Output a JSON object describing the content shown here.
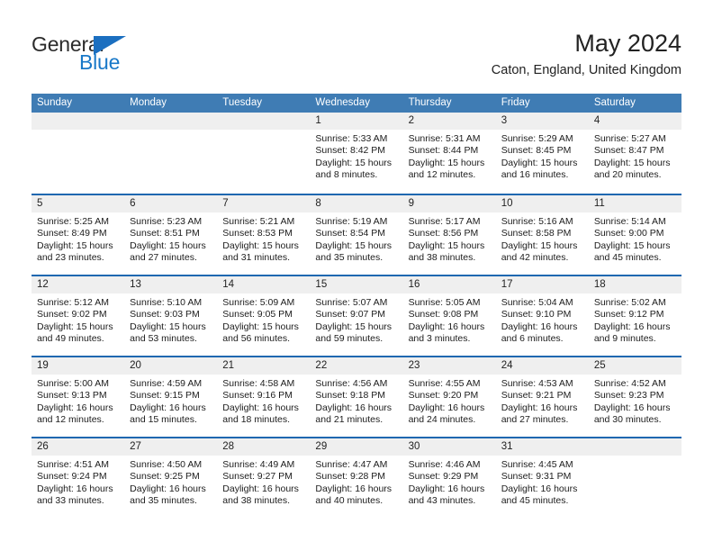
{
  "brand": {
    "name_part1": "General",
    "name_part2": "Blue",
    "logo_icon": "triangle-flag-icon",
    "accent_color": "#1878c8"
  },
  "header": {
    "title": "May 2024",
    "subtitle": "Caton, England, United Kingdom"
  },
  "colors": {
    "weekday_header_bg": "#3f7cb4",
    "week_divider": "#1f68b0",
    "daynum_band_bg": "#efefef",
    "text": "#1c1c1c"
  },
  "weekdays": [
    "Sunday",
    "Monday",
    "Tuesday",
    "Wednesday",
    "Thursday",
    "Friday",
    "Saturday"
  ],
  "weeks": [
    [
      {
        "day": "",
        "empty": true
      },
      {
        "day": "",
        "empty": true
      },
      {
        "day": "",
        "empty": true
      },
      {
        "day": "1",
        "sunrise": "Sunrise: 5:33 AM",
        "sunset": "Sunset: 8:42 PM",
        "daylight_l1": "Daylight: 15 hours",
        "daylight_l2": "and 8 minutes."
      },
      {
        "day": "2",
        "sunrise": "Sunrise: 5:31 AM",
        "sunset": "Sunset: 8:44 PM",
        "daylight_l1": "Daylight: 15 hours",
        "daylight_l2": "and 12 minutes."
      },
      {
        "day": "3",
        "sunrise": "Sunrise: 5:29 AM",
        "sunset": "Sunset: 8:45 PM",
        "daylight_l1": "Daylight: 15 hours",
        "daylight_l2": "and 16 minutes."
      },
      {
        "day": "4",
        "sunrise": "Sunrise: 5:27 AM",
        "sunset": "Sunset: 8:47 PM",
        "daylight_l1": "Daylight: 15 hours",
        "daylight_l2": "and 20 minutes."
      }
    ],
    [
      {
        "day": "5",
        "sunrise": "Sunrise: 5:25 AM",
        "sunset": "Sunset: 8:49 PM",
        "daylight_l1": "Daylight: 15 hours",
        "daylight_l2": "and 23 minutes."
      },
      {
        "day": "6",
        "sunrise": "Sunrise: 5:23 AM",
        "sunset": "Sunset: 8:51 PM",
        "daylight_l1": "Daylight: 15 hours",
        "daylight_l2": "and 27 minutes."
      },
      {
        "day": "7",
        "sunrise": "Sunrise: 5:21 AM",
        "sunset": "Sunset: 8:53 PM",
        "daylight_l1": "Daylight: 15 hours",
        "daylight_l2": "and 31 minutes."
      },
      {
        "day": "8",
        "sunrise": "Sunrise: 5:19 AM",
        "sunset": "Sunset: 8:54 PM",
        "daylight_l1": "Daylight: 15 hours",
        "daylight_l2": "and 35 minutes."
      },
      {
        "day": "9",
        "sunrise": "Sunrise: 5:17 AM",
        "sunset": "Sunset: 8:56 PM",
        "daylight_l1": "Daylight: 15 hours",
        "daylight_l2": "and 38 minutes."
      },
      {
        "day": "10",
        "sunrise": "Sunrise: 5:16 AM",
        "sunset": "Sunset: 8:58 PM",
        "daylight_l1": "Daylight: 15 hours",
        "daylight_l2": "and 42 minutes."
      },
      {
        "day": "11",
        "sunrise": "Sunrise: 5:14 AM",
        "sunset": "Sunset: 9:00 PM",
        "daylight_l1": "Daylight: 15 hours",
        "daylight_l2": "and 45 minutes."
      }
    ],
    [
      {
        "day": "12",
        "sunrise": "Sunrise: 5:12 AM",
        "sunset": "Sunset: 9:02 PM",
        "daylight_l1": "Daylight: 15 hours",
        "daylight_l2": "and 49 minutes."
      },
      {
        "day": "13",
        "sunrise": "Sunrise: 5:10 AM",
        "sunset": "Sunset: 9:03 PM",
        "daylight_l1": "Daylight: 15 hours",
        "daylight_l2": "and 53 minutes."
      },
      {
        "day": "14",
        "sunrise": "Sunrise: 5:09 AM",
        "sunset": "Sunset: 9:05 PM",
        "daylight_l1": "Daylight: 15 hours",
        "daylight_l2": "and 56 minutes."
      },
      {
        "day": "15",
        "sunrise": "Sunrise: 5:07 AM",
        "sunset": "Sunset: 9:07 PM",
        "daylight_l1": "Daylight: 15 hours",
        "daylight_l2": "and 59 minutes."
      },
      {
        "day": "16",
        "sunrise": "Sunrise: 5:05 AM",
        "sunset": "Sunset: 9:08 PM",
        "daylight_l1": "Daylight: 16 hours",
        "daylight_l2": "and 3 minutes."
      },
      {
        "day": "17",
        "sunrise": "Sunrise: 5:04 AM",
        "sunset": "Sunset: 9:10 PM",
        "daylight_l1": "Daylight: 16 hours",
        "daylight_l2": "and 6 minutes."
      },
      {
        "day": "18",
        "sunrise": "Sunrise: 5:02 AM",
        "sunset": "Sunset: 9:12 PM",
        "daylight_l1": "Daylight: 16 hours",
        "daylight_l2": "and 9 minutes."
      }
    ],
    [
      {
        "day": "19",
        "sunrise": "Sunrise: 5:00 AM",
        "sunset": "Sunset: 9:13 PM",
        "daylight_l1": "Daylight: 16 hours",
        "daylight_l2": "and 12 minutes."
      },
      {
        "day": "20",
        "sunrise": "Sunrise: 4:59 AM",
        "sunset": "Sunset: 9:15 PM",
        "daylight_l1": "Daylight: 16 hours",
        "daylight_l2": "and 15 minutes."
      },
      {
        "day": "21",
        "sunrise": "Sunrise: 4:58 AM",
        "sunset": "Sunset: 9:16 PM",
        "daylight_l1": "Daylight: 16 hours",
        "daylight_l2": "and 18 minutes."
      },
      {
        "day": "22",
        "sunrise": "Sunrise: 4:56 AM",
        "sunset": "Sunset: 9:18 PM",
        "daylight_l1": "Daylight: 16 hours",
        "daylight_l2": "and 21 minutes."
      },
      {
        "day": "23",
        "sunrise": "Sunrise: 4:55 AM",
        "sunset": "Sunset: 9:20 PM",
        "daylight_l1": "Daylight: 16 hours",
        "daylight_l2": "and 24 minutes."
      },
      {
        "day": "24",
        "sunrise": "Sunrise: 4:53 AM",
        "sunset": "Sunset: 9:21 PM",
        "daylight_l1": "Daylight: 16 hours",
        "daylight_l2": "and 27 minutes."
      },
      {
        "day": "25",
        "sunrise": "Sunrise: 4:52 AM",
        "sunset": "Sunset: 9:23 PM",
        "daylight_l1": "Daylight: 16 hours",
        "daylight_l2": "and 30 minutes."
      }
    ],
    [
      {
        "day": "26",
        "sunrise": "Sunrise: 4:51 AM",
        "sunset": "Sunset: 9:24 PM",
        "daylight_l1": "Daylight: 16 hours",
        "daylight_l2": "and 33 minutes."
      },
      {
        "day": "27",
        "sunrise": "Sunrise: 4:50 AM",
        "sunset": "Sunset: 9:25 PM",
        "daylight_l1": "Daylight: 16 hours",
        "daylight_l2": "and 35 minutes."
      },
      {
        "day": "28",
        "sunrise": "Sunrise: 4:49 AM",
        "sunset": "Sunset: 9:27 PM",
        "daylight_l1": "Daylight: 16 hours",
        "daylight_l2": "and 38 minutes."
      },
      {
        "day": "29",
        "sunrise": "Sunrise: 4:47 AM",
        "sunset": "Sunset: 9:28 PM",
        "daylight_l1": "Daylight: 16 hours",
        "daylight_l2": "and 40 minutes."
      },
      {
        "day": "30",
        "sunrise": "Sunrise: 4:46 AM",
        "sunset": "Sunset: 9:29 PM",
        "daylight_l1": "Daylight: 16 hours",
        "daylight_l2": "and 43 minutes."
      },
      {
        "day": "31",
        "sunrise": "Sunrise: 4:45 AM",
        "sunset": "Sunset: 9:31 PM",
        "daylight_l1": "Daylight: 16 hours",
        "daylight_l2": "and 45 minutes."
      },
      {
        "day": "",
        "empty": true
      }
    ]
  ]
}
